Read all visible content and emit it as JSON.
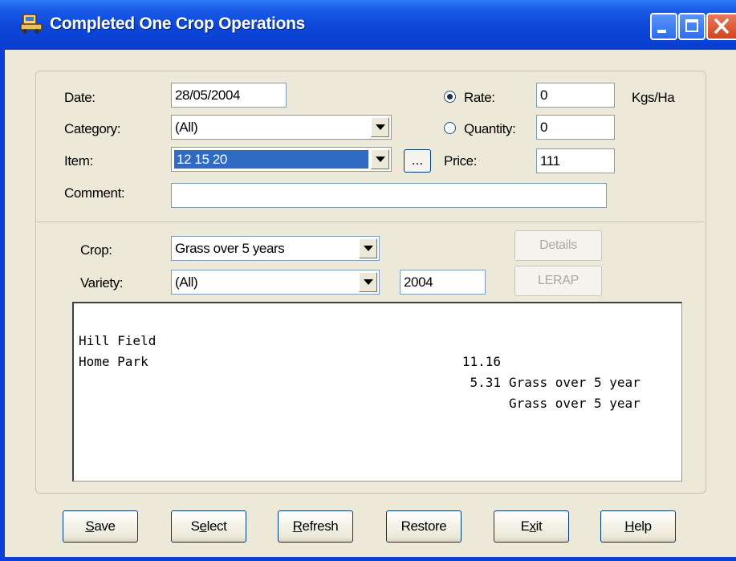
{
  "window": {
    "title": "Completed One Crop Operations"
  },
  "form": {
    "date_label": "Date:",
    "date_value": "28/05/2004",
    "category_label": "Category:",
    "category_value": "(All)",
    "item_label": "Item:",
    "item_value": "12 15 20",
    "browse_label": "...",
    "comment_label": "Comment:",
    "comment_value": "",
    "rate_label": "Rate:",
    "rate_value": "0",
    "rate_unit": "Kgs/Ha",
    "rate_selected": true,
    "quantity_label": "Quantity:",
    "quantity_value": "0",
    "price_label": "Price:",
    "price_value": "111"
  },
  "filters": {
    "crop_label": "Crop:",
    "crop_value": "Grass over 5 years",
    "variety_label": "Variety:",
    "variety_value": "(All)",
    "year_value": "2004",
    "details_label": "Details",
    "lerap_label": "LERAP"
  },
  "fields": [
    {
      "name": "Hill Field",
      "area": "11.16",
      "crop": "Grass over 5 year"
    },
    {
      "name": "Home Park",
      "area": "5.31",
      "crop": "Grass over 5 year"
    }
  ],
  "buttons": {
    "save": {
      "key": "S",
      "rest": "ave"
    },
    "select": {
      "pre": "S",
      "key": "e",
      "rest": "lect"
    },
    "refresh": {
      "key": "R",
      "rest": "efresh"
    },
    "restore": {
      "label": "Restore"
    },
    "exit": {
      "pre": "E",
      "key": "x",
      "rest": "it"
    },
    "help": {
      "key": "H",
      "rest": "elp"
    }
  }
}
